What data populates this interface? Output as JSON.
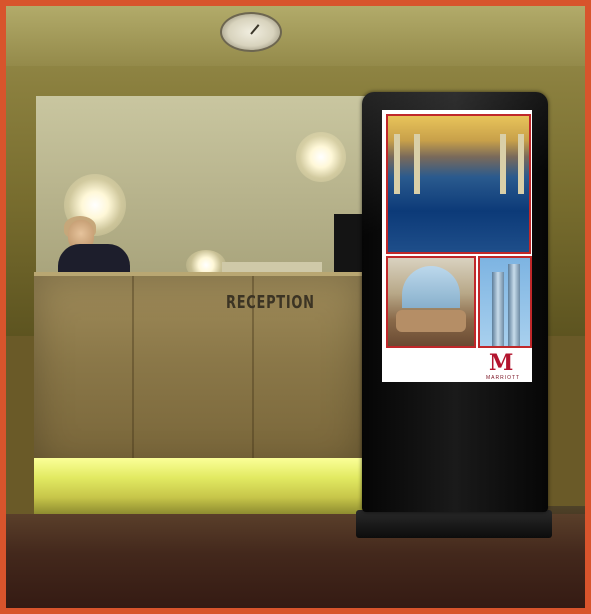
{
  "scene": {
    "desk_sign": "RECEPTION",
    "kiosk_brand_mark": "M",
    "kiosk_brand_name": "MARRIOTT"
  },
  "colors": {
    "frame_border": "#d8542c",
    "brand_red": "#b3142e"
  }
}
